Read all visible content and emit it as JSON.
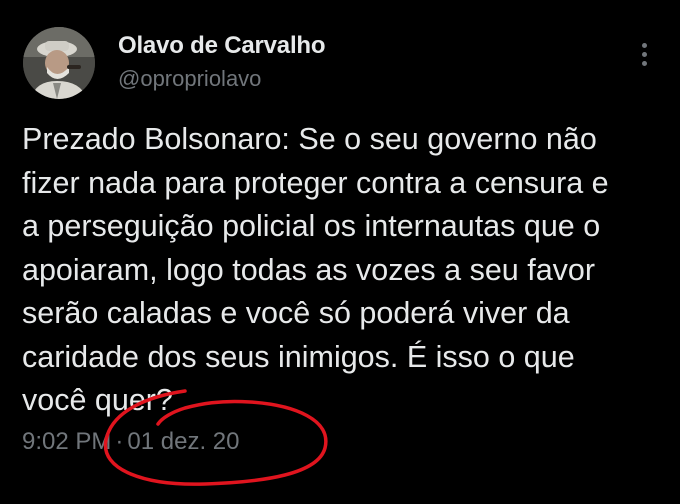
{
  "author": {
    "name": "Olavo de Carvalho",
    "handle": "@opropriolavo",
    "avatar_icon": "profile-photo"
  },
  "more_icon": "vertical-ellipsis-icon",
  "tweet": {
    "lines": [
      "Prezado Bolsonaro: Se o seu governo não",
      "fizer nada para proteger contra a censura e",
      "a perseguição policial os internautas que o",
      "apoiaram, logo todas as vozes a seu favor",
      "serão caladas e você só poderá viver da",
      "caridade dos seus inimigos. É isso o que",
      "você quer?"
    ]
  },
  "meta": {
    "time": "9:02 PM",
    "separator": "·",
    "date": "01 dez. 20"
  },
  "colors": {
    "background": "#000000",
    "text": "#e7e9ea",
    "secondary": "#71767b",
    "annotation": "#e0141e"
  }
}
